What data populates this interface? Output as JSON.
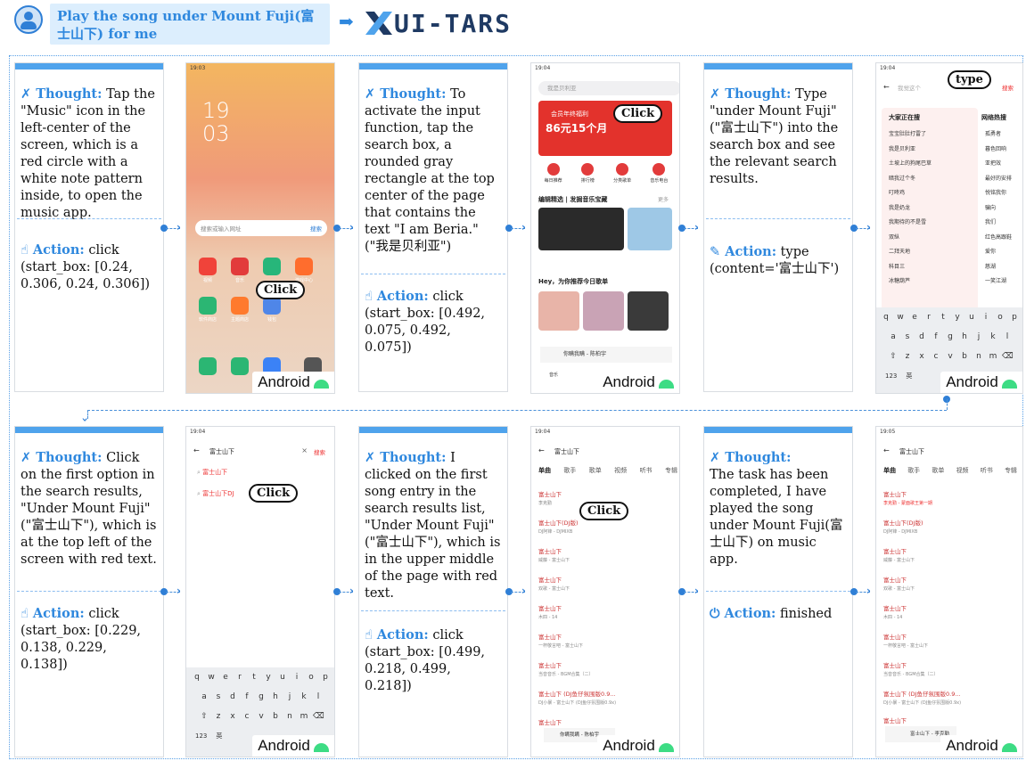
{
  "instruction": "Play the song under Mount Fuji(富士山下) for me",
  "brand": "UI-TARS",
  "thought_label": "Thought:",
  "action_label": "Action:",
  "android_label": "Android",
  "click_label": "Click",
  "type_label": "type",
  "steps": [
    {
      "thought": "Tap the \"Music\" icon in the left-center of the screen, which is a red circle with a white note pattern inside, to open the music app.",
      "action": "click (start_box: [0.24, 0.306, 0.24, 0.306])"
    },
    {
      "thought": "To activate the input function, tap the search box, a rounded gray rectangle at the top center of the page that contains the text \"I am Beria.\" (\"我是贝利亚\")",
      "action": "click (start_box: [0.492, 0.075, 0.492, 0.075])"
    },
    {
      "thought": "Type \"under Mount Fuji\" (\"富士山下\") into the search box and see the relevant search results.",
      "action": "type (content='富士山下')"
    },
    {
      "thought": "Click on the first option in the search results, \"Under Mount Fuji\" (\"富士山下\"), which is at the top left of the screen with red text.",
      "action": "click (start_box: [0.229, 0.138, 0.229, 0.138])"
    },
    {
      "thought": "I clicked on the first song entry in the search results list, \"Under Mount Fuji\"(\"富士山下\"), which is in the upper middle of the page with red text.",
      "action": "click (start_box: [0.499, 0.218, 0.499, 0.218])"
    },
    {
      "thought": "The task has been completed, I have played the song under Mount Fuji(富士山下) on music app.",
      "action": "finished"
    }
  ],
  "screens": {
    "home": {
      "clock_hour": "19",
      "clock_min": "03",
      "search_placeholder": "搜索或输入网址",
      "search_btn": "搜索",
      "apps": [
        "视频",
        "音乐",
        "",
        "游戏中心",
        "软件商店",
        "主题商店",
        "钱包"
      ]
    },
    "music_home": {
      "search_placeholder": "我是贝利亚",
      "banner_top": "会员年终福利",
      "banner_price": "86元15个月",
      "nav": [
        "每日推荐",
        "排行榜",
        "分类歌单",
        "音乐电台"
      ],
      "section1": "编辑精选 | 发掘音乐宝藏",
      "section2": "Hey，为你推荐今日歌单",
      "more": "更多",
      "tabbar": [
        "音乐",
        "",
        "我的"
      ],
      "now_playing": "你瞒我瞒 - 陈柏宇"
    },
    "search_typing": {
      "placeholder": "我觉这个",
      "search_btn": "搜索",
      "col1_title": "大家正在搜",
      "col2_title": "网络热搜",
      "col1": [
        "宝宝肚肚打雷了",
        "我是贝利亚",
        "土坡上的狗尾巴草",
        "暗我过个冬",
        "叮咚鸡",
        "我是奶龙",
        "我期待的不是雪",
        "双纵",
        "二拜天地",
        "科目三",
        "冰糖葫芦"
      ],
      "col2": [
        "孤勇者",
        "暮色回响",
        "亚把效",
        "最好的安排",
        "悦铭我你",
        "骗向",
        "我们",
        "红色高跟鞋",
        "爱你",
        "慈湖",
        "一笑江湖"
      ],
      "keys_row1": [
        "q",
        "w",
        "e",
        "r",
        "t",
        "y",
        "u",
        "i",
        "o",
        "p"
      ],
      "keys_row2": [
        "a",
        "s",
        "d",
        "f",
        "g",
        "h",
        "j",
        "k",
        "l"
      ],
      "keys_row3": [
        "⇧",
        "z",
        "x",
        "c",
        "v",
        "b",
        "n",
        "m",
        "⌫"
      ],
      "keys_row4": [
        "123",
        "英"
      ]
    },
    "search_suggest": {
      "query": "富士山下",
      "close": "×",
      "search_btn": "搜索",
      "suggestions": [
        "富士山下",
        "富士山下DJ"
      ]
    },
    "results": {
      "query": "富士山下",
      "tabs": [
        "单曲",
        "歌手",
        "歌单",
        "视频",
        "听书",
        "专辑"
      ],
      "songs": [
        {
          "title": "富士山下",
          "artist": "李克勤"
        },
        {
          "title": "富士山下(DJ版)",
          "artist": "DJ阿锋 - DJMIXB"
        },
        {
          "title": "富士山下",
          "artist": "威藤 - 富士山下"
        },
        {
          "title": "富士山下",
          "artist": "双歌 - 富士山下"
        },
        {
          "title": "富士山下",
          "artist": "木四 - 14"
        },
        {
          "title": "富士山下",
          "artist": "一杯敬言吧 - 富士山下"
        },
        {
          "title": "富士山下",
          "artist": "当音音乐 - BGM合集（二）"
        },
        {
          "title": "富士山下 (DJ鱼仔氛围版0.9...",
          "artist": "DJ小暴 - 富士山下 (DJ鱼仔氛围版0.9x)"
        },
        {
          "title": "富士山下",
          "artist": ""
        }
      ],
      "now_playing": "你瞒我瞒 - 陈柏宇"
    },
    "results_playing": {
      "first_artist": "李克勤 - 蒙面歌王第一期",
      "now_playing": "富士山下 - 李克勤"
    }
  }
}
